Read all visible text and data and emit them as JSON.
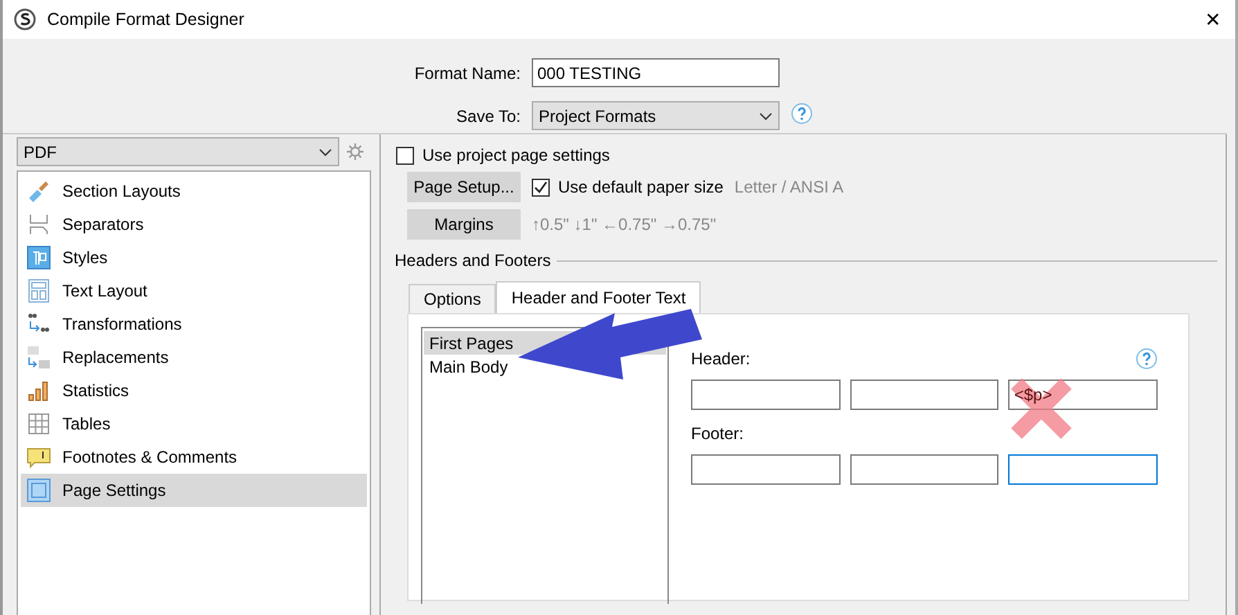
{
  "window": {
    "title": "Compile Format Designer",
    "close": "✕"
  },
  "format_name": {
    "label": "Format Name:",
    "value": "000 TESTING"
  },
  "save_to": {
    "label": "Save To:",
    "value": "Project Formats"
  },
  "output_format": {
    "value": "PDF"
  },
  "sidebar": {
    "items": [
      {
        "label": "Section Layouts",
        "selected": false
      },
      {
        "label": "Separators",
        "selected": false
      },
      {
        "label": "Styles",
        "selected": false
      },
      {
        "label": "Text Layout",
        "selected": false
      },
      {
        "label": "Transformations",
        "selected": false
      },
      {
        "label": "Replacements",
        "selected": false
      },
      {
        "label": "Statistics",
        "selected": false
      },
      {
        "label": "Tables",
        "selected": false
      },
      {
        "label": "Footnotes & Comments",
        "selected": false
      },
      {
        "label": "Page Settings",
        "selected": true
      }
    ]
  },
  "page_settings": {
    "use_project_page_settings": {
      "label": "Use project page settings",
      "checked": false
    },
    "page_setup_button": "Page Setup...",
    "use_default_paper_size": {
      "label": "Use default paper size",
      "checked": true
    },
    "paper_size": "Letter / ANSI A",
    "margins_button": "Margins",
    "margins": "↑0.5\" ↓1\" ←0.75\" →0.75\""
  },
  "headers_and_footers": {
    "title": "Headers and Footers",
    "tabs": [
      {
        "label": "Options",
        "selected": false
      },
      {
        "label": "Header and Footer Text",
        "selected": true
      }
    ],
    "sections": [
      {
        "label": "First Pages",
        "selected": true
      },
      {
        "label": "Main Body",
        "selected": false
      }
    ],
    "header": {
      "label": "Header:",
      "fields": [
        {
          "focused": false
        },
        {
          "focused": false
        },
        {
          "value": "<$p>",
          "focused": false
        }
      ]
    },
    "footer": {
      "label": "Footer:",
      "fields": [
        {
          "focused": false
        },
        {
          "focused": false
        },
        {
          "focused": true
        }
      ]
    }
  }
}
